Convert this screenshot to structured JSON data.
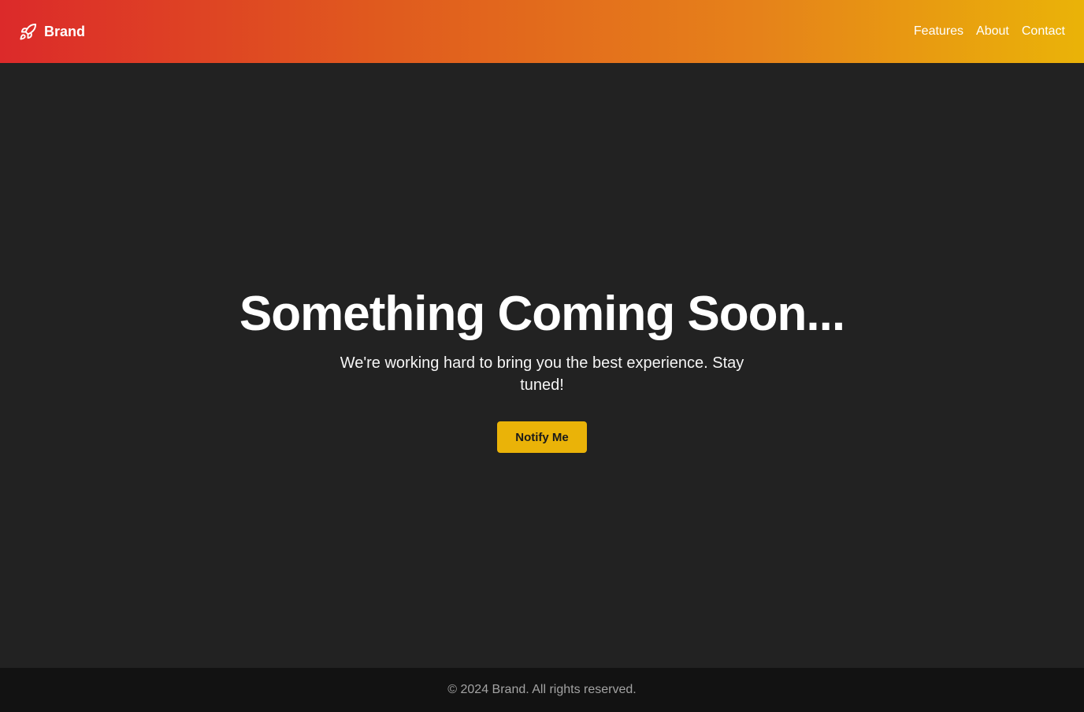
{
  "header": {
    "brand_name": "Brand",
    "brand_icon": "rocket-icon",
    "nav": [
      {
        "label": "Features"
      },
      {
        "label": "About"
      },
      {
        "label": "Contact"
      }
    ]
  },
  "hero": {
    "title": "Something Coming Soon...",
    "subtitle": "We're working hard to bring you the best experience. Stay tuned!",
    "button_label": "Notify Me"
  },
  "footer": {
    "copyright": "© 2024 Brand. All rights reserved."
  },
  "colors": {
    "gradient_start": "#dc2a2a",
    "gradient_end": "#eab308",
    "background": "#222222",
    "footer_bg": "#121212",
    "button": "#eab308"
  }
}
